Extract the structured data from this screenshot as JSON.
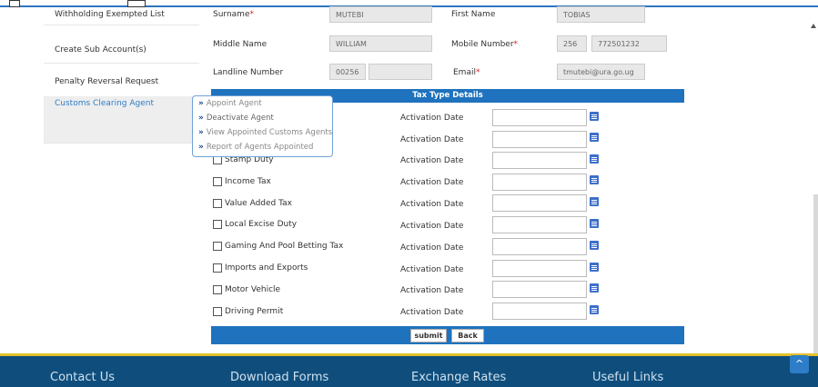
{
  "sidebar": {
    "items": [
      {
        "label": "Withholding Exempted List"
      },
      {
        "label": "Create Sub Account(s)"
      },
      {
        "label": "Penalty Reversal Request"
      },
      {
        "label": "Customs Clearing Agent"
      }
    ]
  },
  "form": {
    "surname_label": "Surname",
    "surname_value": "MUTEBI",
    "first_name_label": "First Name",
    "first_name_value": "TOBIAS",
    "middle_name_label": "Middle Name",
    "middle_name_value": "WILLIAM",
    "mobile_label": "Mobile Number",
    "mobile_code": "256",
    "mobile_value": "772501232",
    "landline_label": "Landline Number",
    "landline_code": "00256",
    "landline_value": "",
    "email_label": "Email",
    "email_value": "tmutebi@ura.go.ug",
    "required_mark": "*"
  },
  "tax_section": {
    "title": "Tax Type Details",
    "activation_label": "Activation Date",
    "rows": [
      {
        "label": ""
      },
      {
        "label": ""
      },
      {
        "label": "Stamp Duty"
      },
      {
        "label": "Income Tax"
      },
      {
        "label": "Value Added Tax"
      },
      {
        "label": "Local Excise Duty"
      },
      {
        "label": "Gaming And Pool Betting Tax"
      },
      {
        "label": "Imports and Exports"
      },
      {
        "label": "Motor Vehicle"
      },
      {
        "label": "Driving Permit"
      }
    ]
  },
  "buttons": {
    "submit": "submit",
    "back": "Back"
  },
  "menu": {
    "arrow": "»",
    "items": [
      {
        "label": "Appoint Agent"
      },
      {
        "label": "Deactivate Agent"
      },
      {
        "label": "View Appointed Customs Agents"
      },
      {
        "label": "Report of Agents Appointed"
      }
    ]
  },
  "footer": {
    "contact": "Contact Us",
    "downloads": "Download Forms",
    "rates": "Exchange Rates",
    "links": "Useful Links",
    "scroll_top": "^"
  }
}
